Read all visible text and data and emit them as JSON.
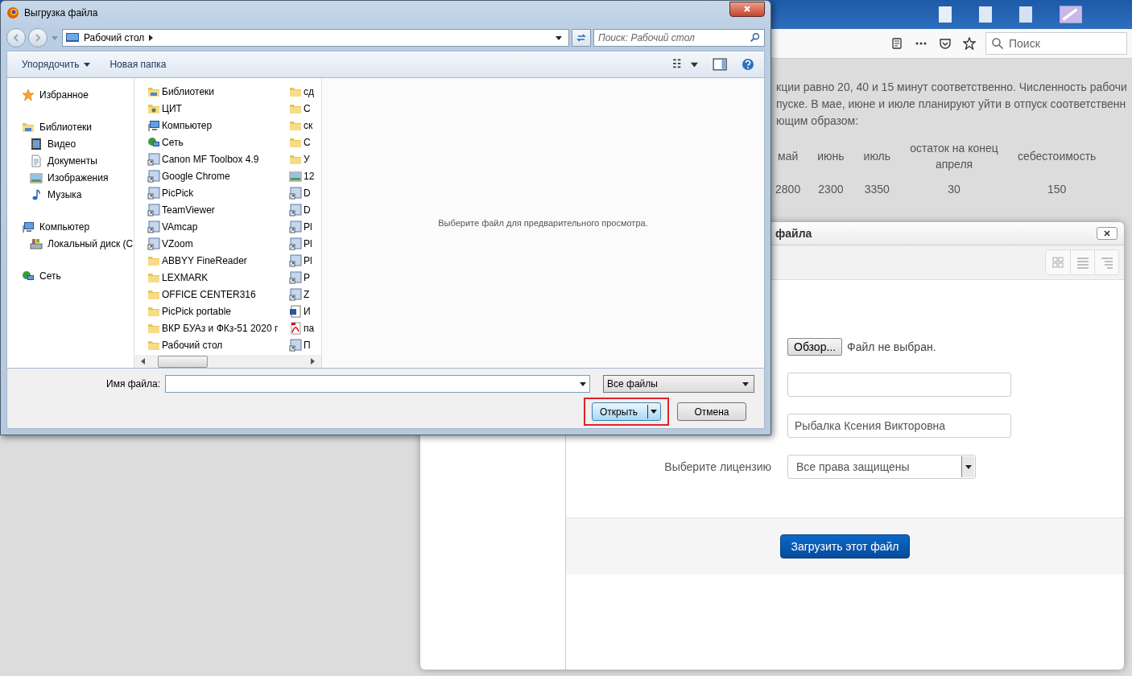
{
  "browser": {
    "search": {
      "placeholder": "Поиск"
    }
  },
  "page": {
    "lines": [
      "кции равно 20, 40 и 15 минут соответственно. Численность рабочи",
      "пуске. В мае, июне и июле планируют уйти в отпуск соответственн",
      "ющим образом:"
    ],
    "table": {
      "columns": [
        "май",
        "июнь",
        "июль",
        "остаток на конец апреля",
        "себестоимость"
      ],
      "rows": [
        [
          "2800",
          "2300",
          "3350",
          "30",
          "150"
        ]
      ]
    }
  },
  "upload_modal": {
    "title": "файла",
    "file_picker": {
      "button": "Обзор...",
      "status": "Файл не выбран."
    },
    "fields": [
      {
        "kind": "input"
      },
      {
        "kind": "input",
        "value": "Рыбалка Ксения Викторовна"
      },
      {
        "kind": "select",
        "label": "Выберите лицензию",
        "value": "Все права защищены"
      }
    ],
    "submit": "Загрузить этот файл"
  },
  "file_dialog": {
    "title": "Выгрузка файла",
    "address": "Рабочий стол",
    "search": {
      "placeholder": "Поиск: Рабочий стол"
    },
    "toolbar": [
      {
        "label": "Упорядочить",
        "kind": "menu"
      },
      {
        "label": "Новая папка",
        "kind": "button"
      }
    ],
    "nav": [
      {
        "label": "Избранное",
        "kind": "star"
      },
      {
        "label": "Библиотеки",
        "kind": "library",
        "children": [
          {
            "label": "Видео",
            "kind": "video"
          },
          {
            "label": "Документы",
            "kind": "document"
          },
          {
            "label": "Изображения",
            "kind": "image"
          },
          {
            "label": "Музыка",
            "kind": "music"
          }
        ]
      },
      {
        "label": "Компьютер",
        "kind": "computer",
        "children": [
          {
            "label": "Локальный диск (С",
            "kind": "disk"
          }
        ]
      },
      {
        "label": "Сеть",
        "kind": "network"
      }
    ],
    "files": [
      {
        "name": "Библиотеки",
        "kind": "library"
      },
      {
        "name": "ЦИТ",
        "kind": "user-folder"
      },
      {
        "name": "Компьютер",
        "kind": "computer"
      },
      {
        "name": "Сеть",
        "kind": "network"
      },
      {
        "name": "Canon MF Toolbox 4.9",
        "kind": "shortcut"
      },
      {
        "name": "Google Chrome",
        "kind": "shortcut"
      },
      {
        "name": "PicPick",
        "kind": "shortcut"
      },
      {
        "name": "TeamViewer",
        "kind": "shortcut"
      },
      {
        "name": "VAmcap",
        "kind": "shortcut"
      },
      {
        "name": "VZoom",
        "kind": "shortcut"
      },
      {
        "name": "ABBYY FineReader",
        "kind": "folder"
      },
      {
        "name": "LEXMARK",
        "kind": "folder"
      },
      {
        "name": "OFFICE CENTER316",
        "kind": "folder"
      },
      {
        "name": "PicPick portable",
        "kind": "folder"
      },
      {
        "name": "ВКР БУАз и ФКз-51 2020 г",
        "kind": "folder"
      },
      {
        "name": "Рабочий стол",
        "kind": "folder"
      },
      {
        "name": "сд",
        "kind": "folder"
      },
      {
        "name": "С",
        "kind": "folder"
      },
      {
        "name": "ск",
        "kind": "folder"
      },
      {
        "name": "С",
        "kind": "folder"
      },
      {
        "name": "У",
        "kind": "folder"
      },
      {
        "name": "12",
        "kind": "image"
      },
      {
        "name": "D",
        "kind": "shortcut"
      },
      {
        "name": "D",
        "kind": "shortcut"
      },
      {
        "name": "Pl",
        "kind": "shortcut"
      },
      {
        "name": "Pl",
        "kind": "shortcut"
      },
      {
        "name": "Pl",
        "kind": "shortcut"
      },
      {
        "name": "P",
        "kind": "shortcut"
      },
      {
        "name": "Z",
        "kind": "shortcut"
      },
      {
        "name": "И",
        "kind": "word"
      },
      {
        "name": "па",
        "kind": "pdf"
      },
      {
        "name": "П",
        "kind": "shortcut"
      }
    ],
    "preview_hint": "Выберите файл для предварительного просмотра.",
    "filename_label": "Имя файла:",
    "filter": "Все файлы",
    "buttons": [
      {
        "label": "Открыть",
        "kind": "split",
        "default": true,
        "highlighted": true
      },
      {
        "label": "Отмена",
        "kind": "plain",
        "default": false,
        "highlighted": false
      }
    ]
  }
}
